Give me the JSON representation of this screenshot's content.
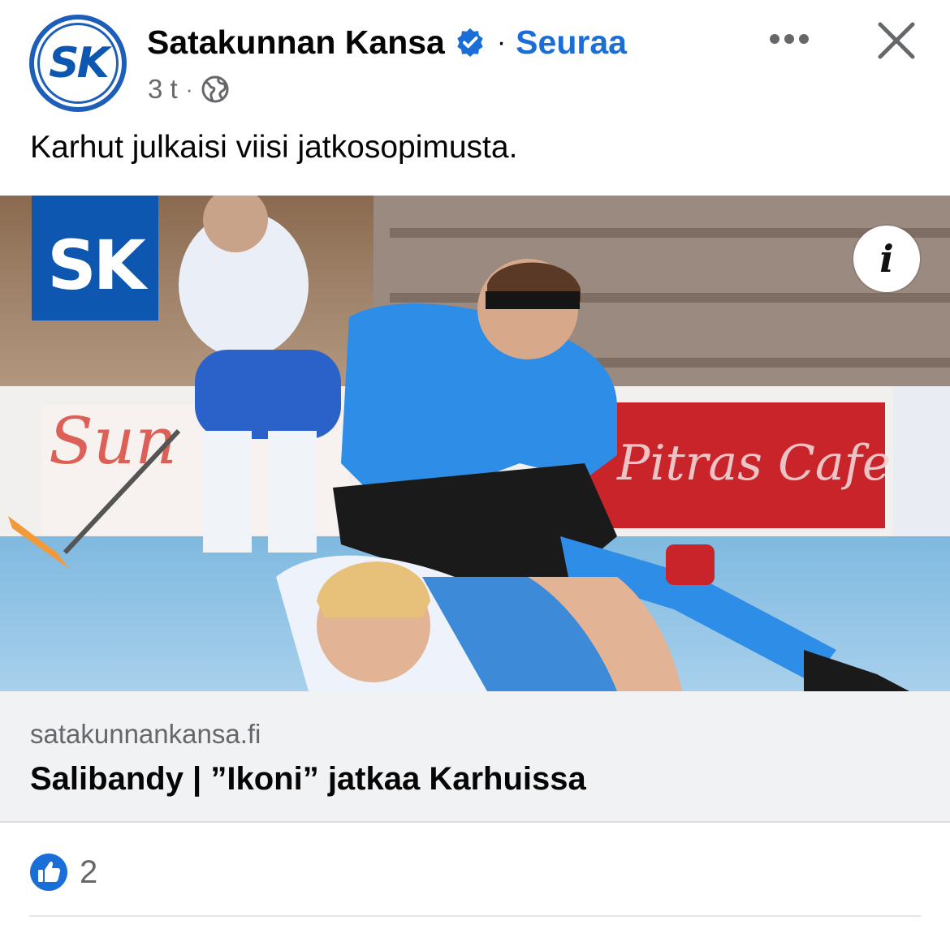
{
  "post": {
    "page_name": "Satakunnan Kansa",
    "avatar_text": "SK",
    "follow_label": "Seuraa",
    "time": "3 t",
    "meta_separator": "·",
    "text": "Karhut julkaisi viisi jatkosopimusta.",
    "image": {
      "logo_text": "SK",
      "info_label": "i"
    }
  },
  "link": {
    "domain": "satakunnankansa.fi",
    "title": "Salibandy | ”Ikoni” jatkaa Karhuissa"
  },
  "reactions": {
    "like_count": "2"
  },
  "colors": {
    "accent": "#1a6ed8",
    "brand": "#0d57b0",
    "link_bg": "#f1f2f4",
    "secondary_text": "#65676b"
  }
}
